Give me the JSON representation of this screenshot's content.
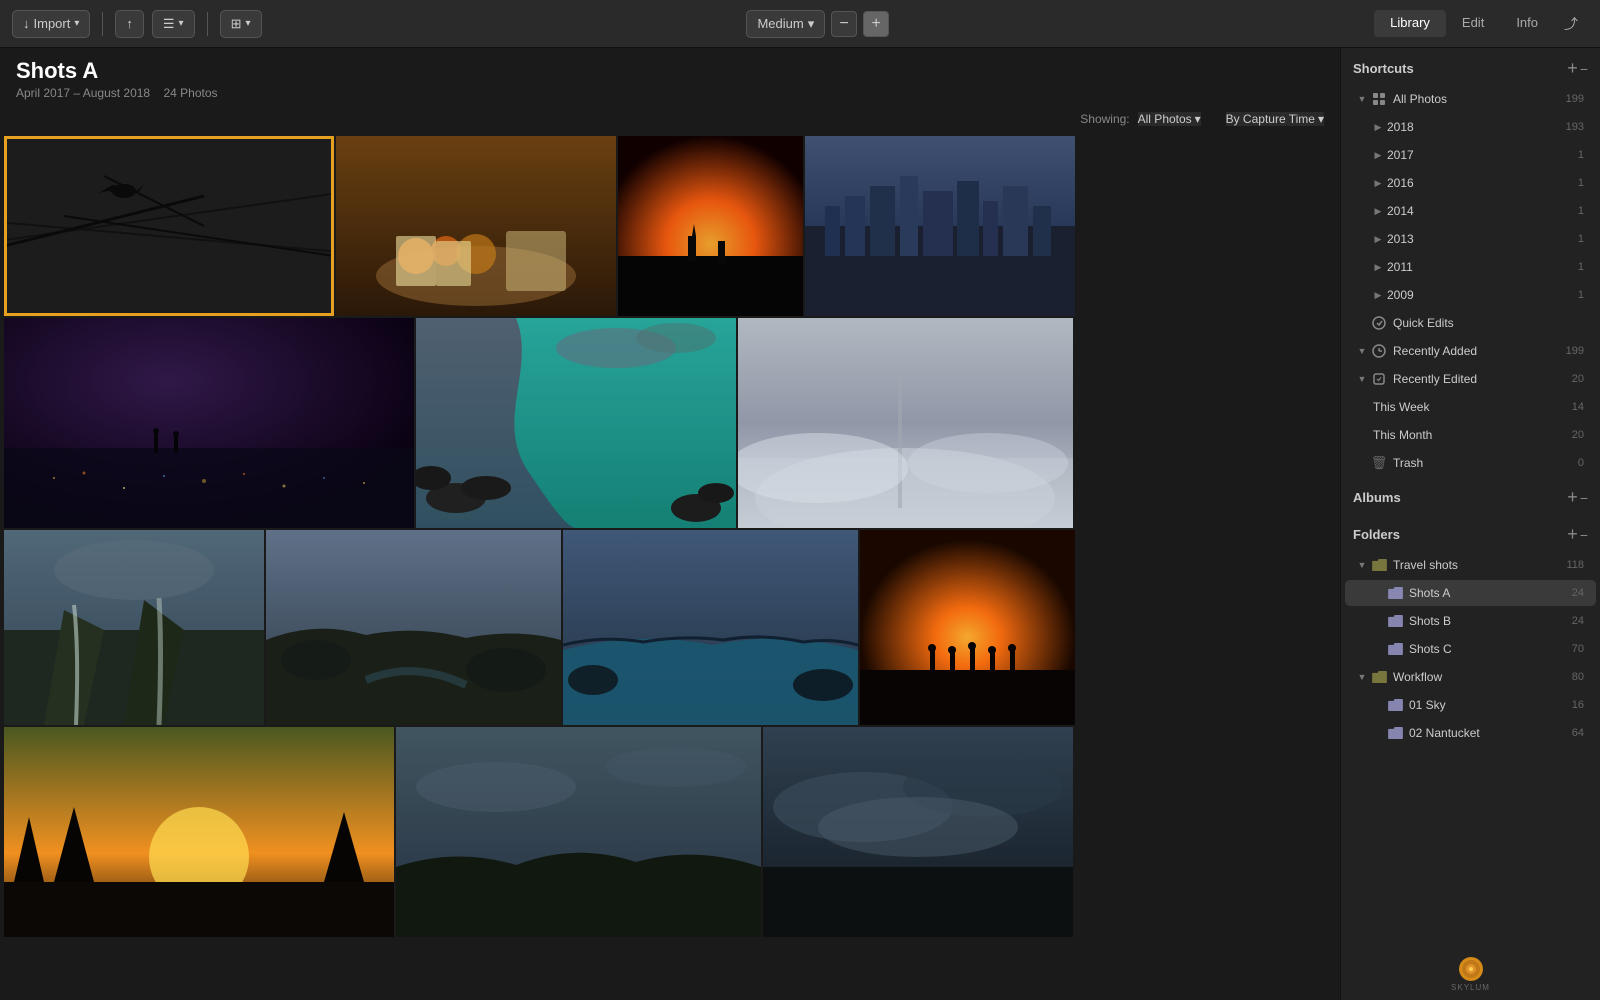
{
  "toolbar": {
    "import_label": "Import",
    "zoom_minus": "−",
    "zoom_plus": "+",
    "medium_label": "Medium",
    "medium_caret": "▾",
    "layout_label": "",
    "tabs": [
      "Library",
      "Edit",
      "Info"
    ],
    "active_tab": "Library",
    "share_icon": "↑"
  },
  "page_header": {
    "title": "Shots A",
    "subtitle": "April 2017 – August 2018",
    "photo_count": "24 Photos"
  },
  "filter_bar": {
    "showing_label": "Showing:",
    "all_photos_label": "All Photos",
    "all_photos_caret": "▾",
    "by_label": "By Capture Time",
    "by_caret": "▾"
  },
  "sidebar": {
    "shortcuts_title": "Shortcuts",
    "add_icon": "+",
    "all_photos_label": "All Photos",
    "all_photos_count": "199",
    "years": [
      {
        "label": "2018",
        "count": "193"
      },
      {
        "label": "2017",
        "count": "1"
      },
      {
        "label": "2016",
        "count": "1"
      },
      {
        "label": "2014",
        "count": "1"
      },
      {
        "label": "2013",
        "count": "1"
      },
      {
        "label": "2011",
        "count": "1"
      },
      {
        "label": "2009",
        "count": "1"
      }
    ],
    "quick_edits_label": "Quick Edits",
    "recently_added_label": "Recently Added",
    "recently_added_count": "199",
    "recently_edited_label": "Recently Edited",
    "recently_edited_count": "20",
    "this_week_label": "This Week",
    "this_week_count": "14",
    "this_month_label": "This Month",
    "this_month_count": "20",
    "trash_label": "Trash",
    "trash_count": "0",
    "albums_title": "Albums",
    "folders_title": "Folders",
    "folders": [
      {
        "label": "Travel shots",
        "count": "118",
        "children": [
          {
            "label": "Shots A",
            "count": "24",
            "active": true
          },
          {
            "label": "Shots B",
            "count": "24"
          },
          {
            "label": "Shots C",
            "count": "70"
          }
        ]
      },
      {
        "label": "Workflow",
        "count": "80",
        "children": [
          {
            "label": "01 Sky",
            "count": "16"
          },
          {
            "label": "02 Nantucket",
            "count": "64"
          }
        ]
      }
    ]
  },
  "photos": [
    {
      "id": 1,
      "class": "p1",
      "selected": true
    },
    {
      "id": 2,
      "class": "p2",
      "selected": false
    },
    {
      "id": 3,
      "class": "p3",
      "selected": false
    },
    {
      "id": 4,
      "class": "p4",
      "selected": false
    },
    {
      "id": 5,
      "class": "p5",
      "selected": false
    },
    {
      "id": 6,
      "class": "p6",
      "selected": false
    },
    {
      "id": 7,
      "class": "p7",
      "selected": false
    },
    {
      "id": 8,
      "class": "p8",
      "selected": false
    },
    {
      "id": 9,
      "class": "p9",
      "selected": false
    },
    {
      "id": 10,
      "class": "p10",
      "selected": false
    },
    {
      "id": 11,
      "class": "p11",
      "selected": false
    },
    {
      "id": 12,
      "class": "p12",
      "selected": false
    },
    {
      "id": 13,
      "class": "p13",
      "selected": false
    },
    {
      "id": 14,
      "class": "p14",
      "selected": false
    }
  ],
  "brand": {
    "name": "SKYLUM",
    "icon": "◉"
  }
}
